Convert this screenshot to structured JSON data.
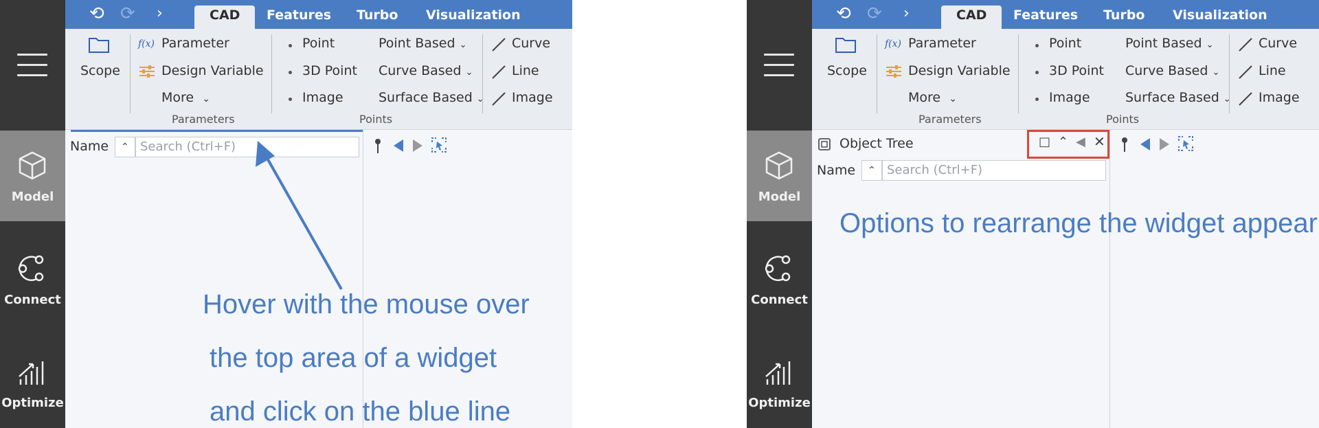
{
  "toolbar": {
    "tabs": [
      "CAD",
      "Features",
      "Turbo",
      "Visualization"
    ],
    "undo_icon": "undo-icon",
    "redo_icon": "redo-icon",
    "more_icon": "chevron-right-icon"
  },
  "sidebar": {
    "items": [
      {
        "label": "Model",
        "icon": "cube-icon",
        "active": true
      },
      {
        "label": "Connect",
        "icon": "connect-icon",
        "active": false
      },
      {
        "label": "Optimize",
        "icon": "optimize-icon",
        "active": false
      }
    ]
  },
  "ribbon": {
    "scope": "Scope",
    "parameter": "Parameter",
    "fx": "f(x)",
    "design_variable": "Design Variable",
    "more": "More",
    "parameters_group": "Parameters",
    "point": "Point",
    "point3d": "3D Point",
    "image": "Image",
    "point_based": "Point Based",
    "curve_based": "Curve Based",
    "surface_based": "Surface Based",
    "points_group": "Points",
    "curve": "Curve",
    "line": "Line",
    "image2": "Image"
  },
  "panel": {
    "object_tree": "Object Tree",
    "name_header": "Name",
    "search_placeholder": "Search (Ctrl+F)"
  },
  "annotations": {
    "left_line1": "Hover with the mouse over",
    "left_line2": "the top area of a widget",
    "left_line3": "and click on the blue line",
    "right": "Options to rearrange the widget appear"
  },
  "colors": {
    "accent": "#4a7cc4",
    "sidebar": "#373737",
    "highlight": "#d9483b"
  }
}
